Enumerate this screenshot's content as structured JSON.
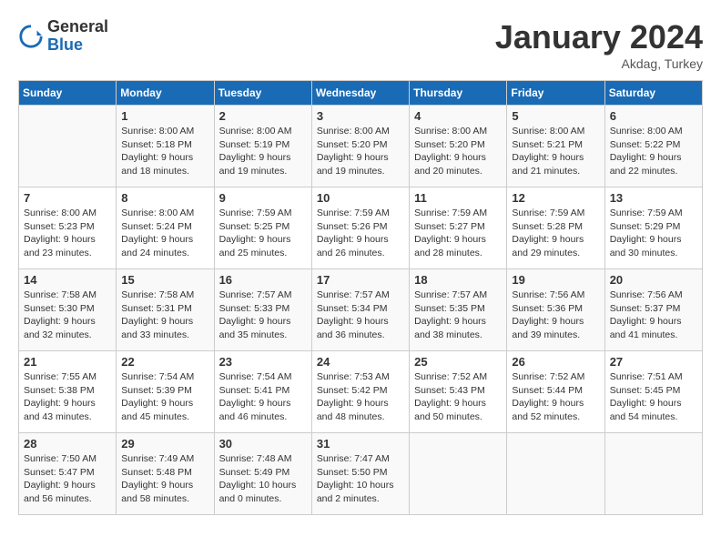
{
  "header": {
    "logo_general": "General",
    "logo_blue": "Blue",
    "month_title": "January 2024",
    "location": "Akdag, Turkey"
  },
  "days_of_week": [
    "Sunday",
    "Monday",
    "Tuesday",
    "Wednesday",
    "Thursday",
    "Friday",
    "Saturday"
  ],
  "weeks": [
    [
      {
        "day": "",
        "sunrise": "",
        "sunset": "",
        "daylight": ""
      },
      {
        "day": "1",
        "sunrise": "Sunrise: 8:00 AM",
        "sunset": "Sunset: 5:18 PM",
        "daylight": "Daylight: 9 hours and 18 minutes."
      },
      {
        "day": "2",
        "sunrise": "Sunrise: 8:00 AM",
        "sunset": "Sunset: 5:19 PM",
        "daylight": "Daylight: 9 hours and 19 minutes."
      },
      {
        "day": "3",
        "sunrise": "Sunrise: 8:00 AM",
        "sunset": "Sunset: 5:20 PM",
        "daylight": "Daylight: 9 hours and 19 minutes."
      },
      {
        "day": "4",
        "sunrise": "Sunrise: 8:00 AM",
        "sunset": "Sunset: 5:20 PM",
        "daylight": "Daylight: 9 hours and 20 minutes."
      },
      {
        "day": "5",
        "sunrise": "Sunrise: 8:00 AM",
        "sunset": "Sunset: 5:21 PM",
        "daylight": "Daylight: 9 hours and 21 minutes."
      },
      {
        "day": "6",
        "sunrise": "Sunrise: 8:00 AM",
        "sunset": "Sunset: 5:22 PM",
        "daylight": "Daylight: 9 hours and 22 minutes."
      }
    ],
    [
      {
        "day": "7",
        "sunrise": "Sunrise: 8:00 AM",
        "sunset": "Sunset: 5:23 PM",
        "daylight": "Daylight: 9 hours and 23 minutes."
      },
      {
        "day": "8",
        "sunrise": "Sunrise: 8:00 AM",
        "sunset": "Sunset: 5:24 PM",
        "daylight": "Daylight: 9 hours and 24 minutes."
      },
      {
        "day": "9",
        "sunrise": "Sunrise: 7:59 AM",
        "sunset": "Sunset: 5:25 PM",
        "daylight": "Daylight: 9 hours and 25 minutes."
      },
      {
        "day": "10",
        "sunrise": "Sunrise: 7:59 AM",
        "sunset": "Sunset: 5:26 PM",
        "daylight": "Daylight: 9 hours and 26 minutes."
      },
      {
        "day": "11",
        "sunrise": "Sunrise: 7:59 AM",
        "sunset": "Sunset: 5:27 PM",
        "daylight": "Daylight: 9 hours and 28 minutes."
      },
      {
        "day": "12",
        "sunrise": "Sunrise: 7:59 AM",
        "sunset": "Sunset: 5:28 PM",
        "daylight": "Daylight: 9 hours and 29 minutes."
      },
      {
        "day": "13",
        "sunrise": "Sunrise: 7:59 AM",
        "sunset": "Sunset: 5:29 PM",
        "daylight": "Daylight: 9 hours and 30 minutes."
      }
    ],
    [
      {
        "day": "14",
        "sunrise": "Sunrise: 7:58 AM",
        "sunset": "Sunset: 5:30 PM",
        "daylight": "Daylight: 9 hours and 32 minutes."
      },
      {
        "day": "15",
        "sunrise": "Sunrise: 7:58 AM",
        "sunset": "Sunset: 5:31 PM",
        "daylight": "Daylight: 9 hours and 33 minutes."
      },
      {
        "day": "16",
        "sunrise": "Sunrise: 7:57 AM",
        "sunset": "Sunset: 5:33 PM",
        "daylight": "Daylight: 9 hours and 35 minutes."
      },
      {
        "day": "17",
        "sunrise": "Sunrise: 7:57 AM",
        "sunset": "Sunset: 5:34 PM",
        "daylight": "Daylight: 9 hours and 36 minutes."
      },
      {
        "day": "18",
        "sunrise": "Sunrise: 7:57 AM",
        "sunset": "Sunset: 5:35 PM",
        "daylight": "Daylight: 9 hours and 38 minutes."
      },
      {
        "day": "19",
        "sunrise": "Sunrise: 7:56 AM",
        "sunset": "Sunset: 5:36 PM",
        "daylight": "Daylight: 9 hours and 39 minutes."
      },
      {
        "day": "20",
        "sunrise": "Sunrise: 7:56 AM",
        "sunset": "Sunset: 5:37 PM",
        "daylight": "Daylight: 9 hours and 41 minutes."
      }
    ],
    [
      {
        "day": "21",
        "sunrise": "Sunrise: 7:55 AM",
        "sunset": "Sunset: 5:38 PM",
        "daylight": "Daylight: 9 hours and 43 minutes."
      },
      {
        "day": "22",
        "sunrise": "Sunrise: 7:54 AM",
        "sunset": "Sunset: 5:39 PM",
        "daylight": "Daylight: 9 hours and 45 minutes."
      },
      {
        "day": "23",
        "sunrise": "Sunrise: 7:54 AM",
        "sunset": "Sunset: 5:41 PM",
        "daylight": "Daylight: 9 hours and 46 minutes."
      },
      {
        "day": "24",
        "sunrise": "Sunrise: 7:53 AM",
        "sunset": "Sunset: 5:42 PM",
        "daylight": "Daylight: 9 hours and 48 minutes."
      },
      {
        "day": "25",
        "sunrise": "Sunrise: 7:52 AM",
        "sunset": "Sunset: 5:43 PM",
        "daylight": "Daylight: 9 hours and 50 minutes."
      },
      {
        "day": "26",
        "sunrise": "Sunrise: 7:52 AM",
        "sunset": "Sunset: 5:44 PM",
        "daylight": "Daylight: 9 hours and 52 minutes."
      },
      {
        "day": "27",
        "sunrise": "Sunrise: 7:51 AM",
        "sunset": "Sunset: 5:45 PM",
        "daylight": "Daylight: 9 hours and 54 minutes."
      }
    ],
    [
      {
        "day": "28",
        "sunrise": "Sunrise: 7:50 AM",
        "sunset": "Sunset: 5:47 PM",
        "daylight": "Daylight: 9 hours and 56 minutes."
      },
      {
        "day": "29",
        "sunrise": "Sunrise: 7:49 AM",
        "sunset": "Sunset: 5:48 PM",
        "daylight": "Daylight: 9 hours and 58 minutes."
      },
      {
        "day": "30",
        "sunrise": "Sunrise: 7:48 AM",
        "sunset": "Sunset: 5:49 PM",
        "daylight": "Daylight: 10 hours and 0 minutes."
      },
      {
        "day": "31",
        "sunrise": "Sunrise: 7:47 AM",
        "sunset": "Sunset: 5:50 PM",
        "daylight": "Daylight: 10 hours and 2 minutes."
      },
      {
        "day": "",
        "sunrise": "",
        "sunset": "",
        "daylight": ""
      },
      {
        "day": "",
        "sunrise": "",
        "sunset": "",
        "daylight": ""
      },
      {
        "day": "",
        "sunrise": "",
        "sunset": "",
        "daylight": ""
      }
    ]
  ]
}
